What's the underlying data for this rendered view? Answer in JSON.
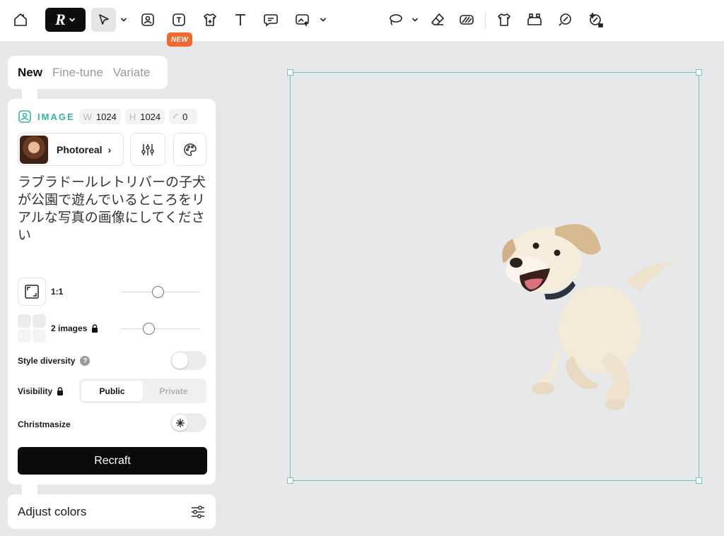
{
  "toolbar": {
    "new_badge": "NEW",
    "logo_glyph": "R",
    "tools": [
      "home-icon",
      "select-icon",
      "image-icon",
      "text-image-icon",
      "mockup-icon",
      "text-icon",
      "comment-icon",
      "upload-icon",
      "lasso-icon",
      "eraser-icon",
      "pattern-icon",
      "shirt-icon",
      "vectorize-icon",
      "brush-icon",
      "magic-icon"
    ]
  },
  "tabs": [
    "New",
    "Fine-tune",
    "Variate"
  ],
  "active_tab": "New",
  "panel": {
    "image_label": "IMAGE",
    "width_key": "W",
    "width_value": "1024",
    "height_key": "H",
    "height_value": "1024",
    "rotation_value": "0",
    "model_name": "Photoreal",
    "prompt": "ラブラドールレトリバーの子犬が公園で遊んでいるところをリアルな写真の画像にしてください",
    "ratio_label": "1:1",
    "ratio_position": 0.47,
    "images_label": "2 images",
    "images_position": 0.35,
    "style_diversity_label": "Style diversity",
    "style_diversity_on": false,
    "visibility_label": "Visibility",
    "visibility_options": [
      "Public",
      "Private"
    ],
    "visibility_selected": "Public",
    "christmasize_label": "Christmasize",
    "christmasize_on": false,
    "recraft_button": "Recraft"
  },
  "adjust_colors": "Adjust colors",
  "colors": {
    "accent": "#37b3a4",
    "frame": "#6cc6bb",
    "badge": "#f06a2e"
  }
}
